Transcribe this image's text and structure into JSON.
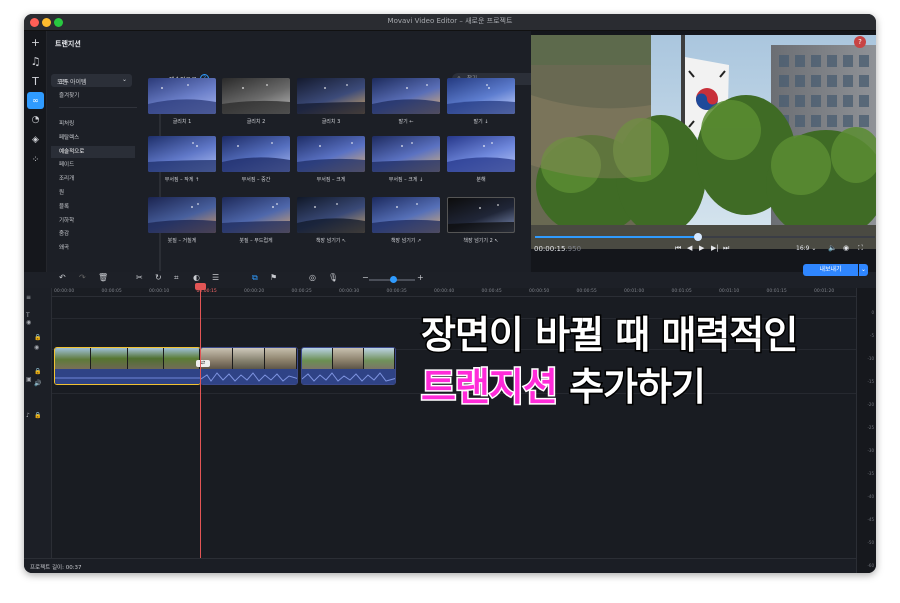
{
  "window": {
    "title": "Movavi Video Editor – 새로운 프로젝트"
  },
  "transitions_panel": {
    "title": "트랜지션",
    "filter_dropdown": "모든 아이템",
    "top_categories": [
      "모두",
      "즐겨찾기"
    ],
    "categories": [
      "피처링",
      "페탈렉스",
      "예술적으로",
      "페이드",
      "조리개",
      "원",
      "블록",
      "기하학",
      "줌감",
      "왜곡"
    ],
    "selected_category": "예술적으로",
    "section_title": "예술적으로",
    "search_placeholder": "찾기",
    "tiles": [
      "글리치 1",
      "글리치 2",
      "글리치 3",
      "말기 ←",
      "말기 ↓",
      "부서짐 – 작게 ↑",
      "부서짐 – 중간",
      "부서짐 – 크게",
      "부서짐 – 크게 ↓",
      "분해",
      "붓질 – 거칠게",
      "붓질 – 부드럽게",
      "책장 넘기기 ↖",
      "책장 넘기기 ↗",
      "책장 넘기기 2 ↖"
    ]
  },
  "preview": {
    "time_main": "00:00:15",
    "time_ms": ".950",
    "progress": 0.48,
    "aspect": "16:9"
  },
  "timeline": {
    "export_label": "내보내기",
    "ruler": [
      "00:00:00",
      "00:00:05",
      "00:00:10",
      "00:00:15",
      "00:00:20",
      "00:00:25",
      "00:00:30",
      "00:00:35",
      "00:00:40",
      "00:00:45",
      "00:00:50",
      "00:00:55",
      "00:01:00",
      "00:01:05",
      "00:01:10",
      "00:01:15",
      "00:01:20"
    ],
    "meter": [
      "0",
      "-5",
      "-10",
      "-15",
      "-20",
      "-25",
      "-30",
      "-35",
      "-40",
      "-45",
      "-50",
      "-60"
    ]
  },
  "status": {
    "duration": "프로젝트 길이: 00:37"
  },
  "overlay": {
    "line1": "장면이 바뀔 때 매력적인",
    "line2_highlight": "트랜지션",
    "line2_rest": " 추가하기"
  },
  "colors": {
    "accent": "#2f9bff",
    "highlight": "#ff2bd9",
    "playhead": "#e25555"
  }
}
